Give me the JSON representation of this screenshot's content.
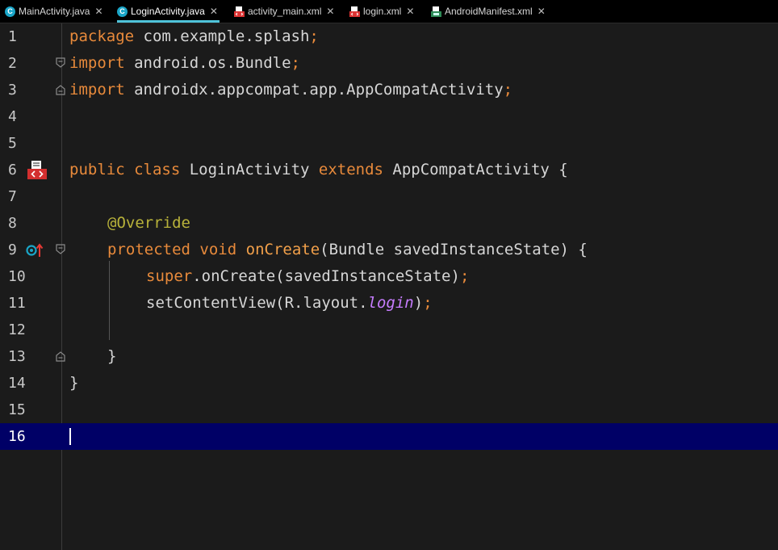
{
  "tabs": [
    {
      "label": "MainActivity.java",
      "icon": "class-icon",
      "active": false
    },
    {
      "label": "LoginActivity.java",
      "icon": "class-icon",
      "active": true
    },
    {
      "label": "activity_main.xml",
      "icon": "layout-xml-icon",
      "active": false
    },
    {
      "label": "login.xml",
      "icon": "layout-xml-icon",
      "active": false
    },
    {
      "label": "AndroidManifest.xml",
      "icon": "manifest-xml-icon",
      "active": false
    }
  ],
  "tab_close": "✕",
  "class_icon_glyph": "C",
  "colors": {
    "keyword": "#e88a3b",
    "annotation": "#b8b23a",
    "method": "#f2a04a",
    "field_italic": "#c77dff",
    "text": "#d6d6d6",
    "current_line": "#000066",
    "active_tab_underline": "#4fc3d9"
  },
  "lines": {
    "n1": "1",
    "n2": "2",
    "n3": "3",
    "n4": "4",
    "n5": "5",
    "n6": "6",
    "n7": "7",
    "n8": "8",
    "n9": "9",
    "n10": "10",
    "n11": "11",
    "n12": "12",
    "n13": "13",
    "n14": "14",
    "n15": "15",
    "n16": "16"
  },
  "code": {
    "l1": {
      "kw": "package",
      "rest": " com.example.splash",
      "semi": ";"
    },
    "l2": {
      "kw": "import",
      "rest": " android.os.Bundle",
      "semi": ";"
    },
    "l3": {
      "kw": "import",
      "rest": " androidx.appcompat.app.AppCompatActivity",
      "semi": ";"
    },
    "l6": {
      "kw1": "public",
      "kw2": "class",
      "name": " LoginActivity ",
      "kw3": "extends",
      "rest": " AppCompatActivity {"
    },
    "l8": {
      "ann": "@Override"
    },
    "l9": {
      "kw1": "protected",
      "kw2": "void",
      "fn": "onCreate",
      "rest": "(Bundle savedInstanceState) {"
    },
    "l10": {
      "kw": "super",
      "rest": ".onCreate(savedInstanceState)",
      "semi": ";"
    },
    "l11": {
      "rest": "setContentView(R.layout.",
      "field": "login",
      "close": ")",
      "semi": ";"
    },
    "l13": {
      "rest": "}"
    },
    "l14": {
      "rest": "}"
    }
  }
}
